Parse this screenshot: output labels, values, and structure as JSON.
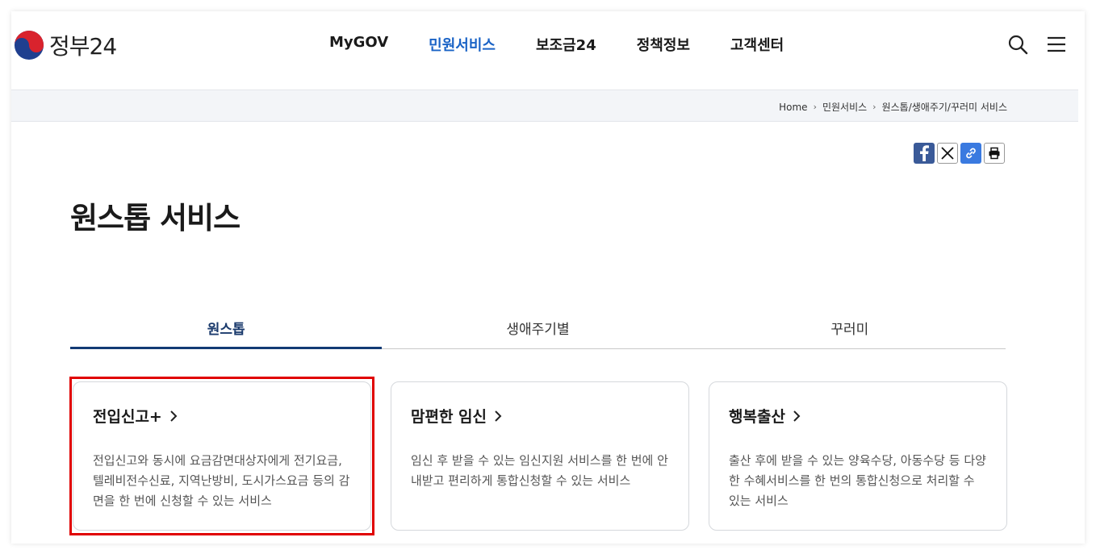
{
  "header": {
    "logo_text": "정부24",
    "nav": [
      "MyGOV",
      "민원서비스",
      "보조금24",
      "정책정보",
      "고객센터"
    ],
    "active_nav": 1,
    "search_icon": "search-icon",
    "menu_icon": "hamburger-menu-icon"
  },
  "breadcrumb": [
    "Home",
    "민원서비스",
    "원스톱/생애주기/꾸러미 서비스"
  ],
  "share": [
    "facebook-icon",
    "x-icon",
    "link-icon",
    "print-icon"
  ],
  "page_title": "원스톱 서비스",
  "tabs": [
    "원스톱",
    "생애주기별",
    "꾸러미"
  ],
  "active_tab": 0,
  "cards": [
    {
      "title": "전입신고+",
      "desc": "전입신고와 동시에 요금감면대상자에게 전기요금, 텔레비전수신료, 지역난방비, 도시가스요금 등의 감면을 한 번에 신청할 수 있는 서비스"
    },
    {
      "title": "맘편한 임신",
      "desc": "임신 후 받을 수 있는 임신지원 서비스를 한 번에 안내받고 편리하게 통합신청할 수 있는 서비스"
    },
    {
      "title": "행복출산",
      "desc": "출산 후에 받을 수 있는 양육수당, 아동수당 등 다양한 수혜서비스를 한 번의 통합신청으로 처리할 수 있는 서비스"
    }
  ],
  "colors": {
    "accent": "#1a63c6",
    "tab_underline": "#123a74",
    "highlight": "#e00000"
  }
}
